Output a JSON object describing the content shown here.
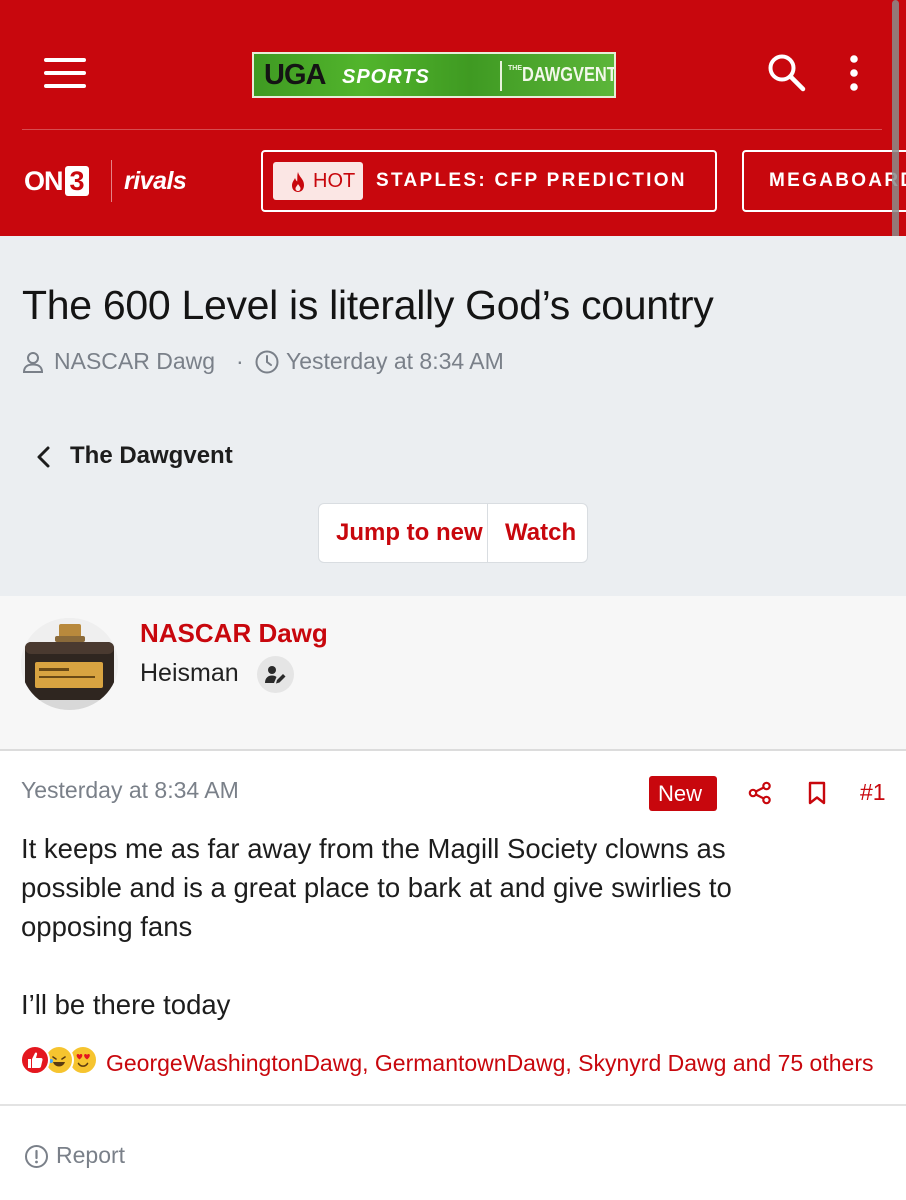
{
  "header": {
    "brand": {
      "uga": "UGA",
      "sports": "SPORTS",
      "the": "THE",
      "dawgvent": "DAWGVENT"
    },
    "on3": {
      "on": "ON",
      "three": "3"
    },
    "rivals": "rivals",
    "pills": [
      {
        "badge": "HOT",
        "label": "STAPLES: CFP PREDICTION"
      },
      {
        "label": "MEGABOARD"
      }
    ]
  },
  "thread": {
    "title": "The 600 Level is literally God’s country",
    "author": "NASCAR Dawg",
    "separator": "·",
    "date": "Yesterday at 8:34 AM",
    "back_label": "The Dawgvent",
    "buttons": {
      "jump": "Jump to new",
      "watch": "Watch"
    }
  },
  "poster": {
    "name": "NASCAR Dawg",
    "title": "Heisman"
  },
  "post": {
    "date": "Yesterday at 8:34 AM",
    "new_label": "New",
    "number": "#1",
    "lines": [
      "It keeps me as far away from the Magill Society clowns as",
      "possible and is a great place to bark at and give swirlies to",
      "opposing fans",
      "I’ll be there today"
    ],
    "reactions_text": "GeorgeWashingtonDawg, GermantownDawg, Skynyrd Dawg and 75 others",
    "reaction_icons": [
      "like-icon",
      "laugh-icon",
      "love-icon"
    ]
  },
  "footer": {
    "report": "Report"
  },
  "colors": {
    "accent": "#c8070d",
    "page_bg": "#ebeef1",
    "muted": "#7a8089"
  }
}
